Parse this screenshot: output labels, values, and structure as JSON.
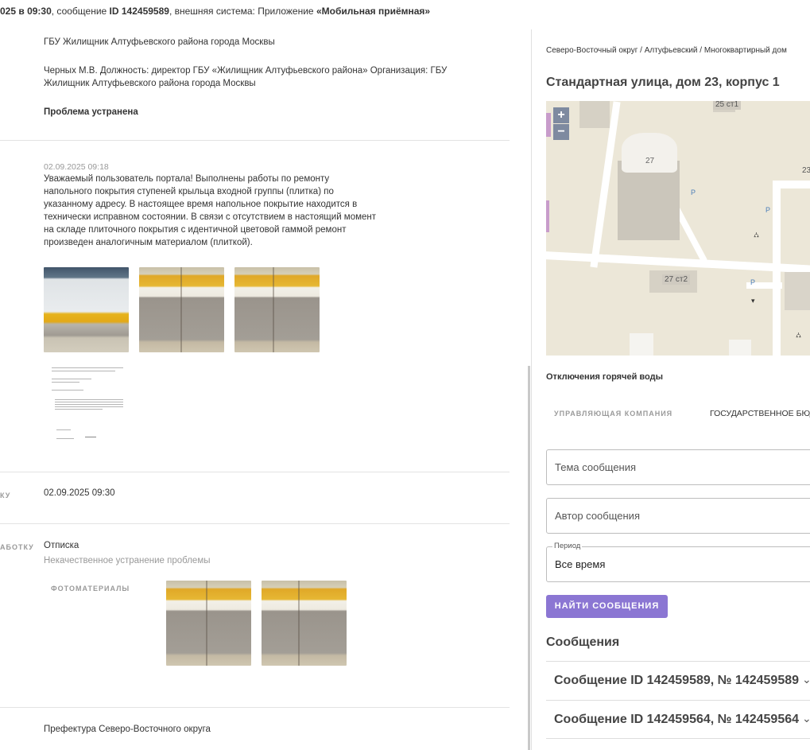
{
  "topbar": {
    "date_part": "025 в 09:30",
    "msg_prefix": ", сообщение ",
    "msg_id": "ID 142459589",
    "sys_prefix": ", внешняя система: Приложение ",
    "sys_name": "«Мобильная приёмная»"
  },
  "left": {
    "org_name": "ГБУ Жилищник Алтуфьевского района города Москвы",
    "official": "Черных М.В. Должность: директор ГБУ «Жилищник Алтуфьевского района» Организация: ГБУ Жилищник Алтуфьевского района города Москвы",
    "status": "Проблема устранена",
    "reply_date": "02.09.2025 09:18",
    "reply_text": "Уважаемый пользователь портала! Выполнены работы по ремонту напольного покрытия ступеней крыльца входной группы (плитка) по указанному адресу. В настоящее время напольное покрытие находится в технически исправном состоянии. В связи с отсутствием в настоящий момент на складе плиточного покрытия с идентичной цветовой гаммой ремонт произведен аналогичным материалом (плиткой).",
    "row1_label": "КУ",
    "row1_value": "02.09.2025 09:30",
    "row2_label": "АБОТКУ",
    "row2_value": "Отписка",
    "row2_sub": "Некачественное устранение проблемы",
    "photos_label": "ФОТОМАТЕРИАЛЫ",
    "prefecture": "Префектура Северо-Восточного округа"
  },
  "right": {
    "breadcrumb": "Северо-Восточный округ / Алтуфьевский / Многоквартирный дом",
    "address": "Стандартная улица, дом 23, корпус 1",
    "map": {
      "zoom_in": "+",
      "zoom_out": "−",
      "labels": [
        "25 ст1",
        "27",
        "23",
        "27 ст2"
      ]
    },
    "hot_water": "Отключения горячей воды",
    "company_label": "УПРАВЛЯЮЩАЯ КОМПАНИЯ",
    "company_value": "ГОСУДАРСТВЕННОЕ БЮД",
    "subject_placeholder": "Тема сообщения",
    "author_placeholder": "Автор сообщения",
    "period_label": "Период",
    "period_value": "Все время",
    "search_button": "Найти сообщения",
    "messages_title": "Сообщения",
    "messages": [
      "Сообщение ID 142459589, № 142459589",
      "Сообщение ID 142459564, № 142459564"
    ]
  },
  "colors": {
    "accent": "#8b76d3",
    "map_bg": "#ece7d8"
  }
}
